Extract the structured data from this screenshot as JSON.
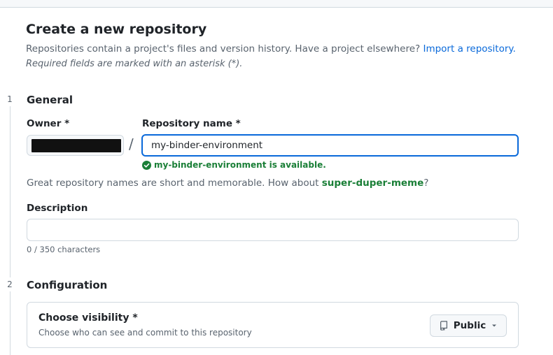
{
  "header": {
    "title": "Create a new repository",
    "intro_text": "Repositories contain a project's files and version history. Have a project elsewhere? ",
    "import_link": "Import a repository.",
    "required_note": "Required fields are marked with an asterisk (*)."
  },
  "steps": [
    {
      "number": "1",
      "title": "General"
    },
    {
      "number": "2",
      "title": "Configuration"
    }
  ],
  "general": {
    "owner_label": "Owner *",
    "separator": "/",
    "repo_name_label": "Repository name *",
    "repo_name_value": "my-binder-environment",
    "availability_message": "my-binder-environment is available.",
    "hint_prefix": "Great repository names are short and memorable. How about ",
    "suggested_name": "super-duper-meme",
    "hint_suffix": "?",
    "description_label": "Description",
    "description_value": "",
    "description_counter": "0 / 350 characters"
  },
  "configuration": {
    "visibility_title": "Choose visibility *",
    "visibility_subtitle": "Choose who can see and commit to this repository",
    "visibility_value": "Public"
  },
  "icons": {
    "availability": "check-circle-icon",
    "visibility": "repo-icon",
    "dropdown": "triangle-down-icon"
  },
  "colors": {
    "accent": "#0969da",
    "success": "#1a7f37",
    "muted_text": "#59636e",
    "border": "#d1d9e0"
  }
}
